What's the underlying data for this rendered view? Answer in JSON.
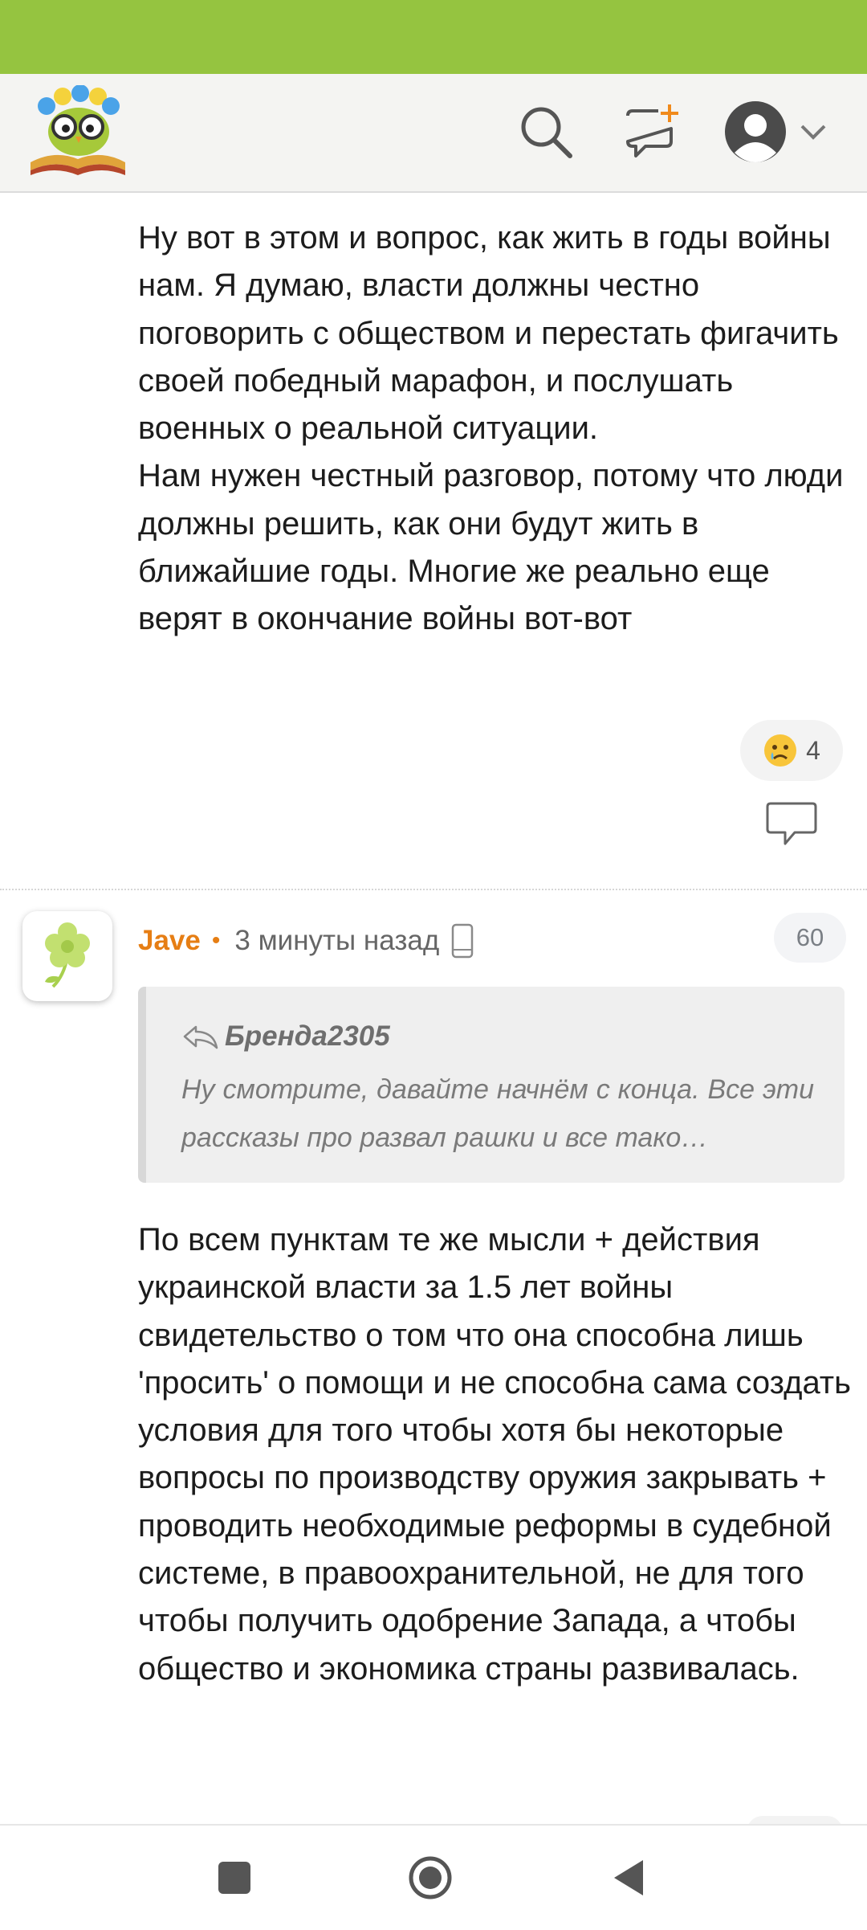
{
  "header": {
    "logo_icon": "owl-on-book-logo",
    "search_icon": "search-icon",
    "new_post_icon": "new-message-plus-icon",
    "profile_icon": "user-avatar-icon"
  },
  "comment1": {
    "text": "Ну вот в этом и вопрос, как жить в годы войны нам. Я думаю, власти должны честно поговорить с обществом и перестать фигачить своей победный марафон, и послушать военных о реальной ситуации.\nНам нужен честный разговор, потому что люди должны решить, как они будут жить в ближайшие годы. Многие же реально еще верят в окончание войны вот-вот",
    "reaction_emoji": "crying-face",
    "reaction_count": "4"
  },
  "comment2": {
    "author": "Jave",
    "separator": "•",
    "time": "3 минуты назад",
    "rating": "60",
    "quote": {
      "author": "Бренда2305",
      "text": "Ну смотрите, давайте начнём с конца. Все эти рассказы про развал рашки и все тако…"
    },
    "text": "По всем пунктам те же мысли + действия украинской власти за 1.5 лет войны свидетельство о том что она способна лишь 'просить' о помощи и не способна сама создать условия для того чтобы хотя бы некоторые вопросы по производству оружия закрывать + проводить необходимые реформы в судебной системе, в правоохранительной, не для того чтобы получить одобрение Запада, а чтобы общество и экономика страны развивалась."
  },
  "colors": {
    "status_bar": "#95c440",
    "author": "#e67e14",
    "header_bg": "#f4f4f2"
  }
}
